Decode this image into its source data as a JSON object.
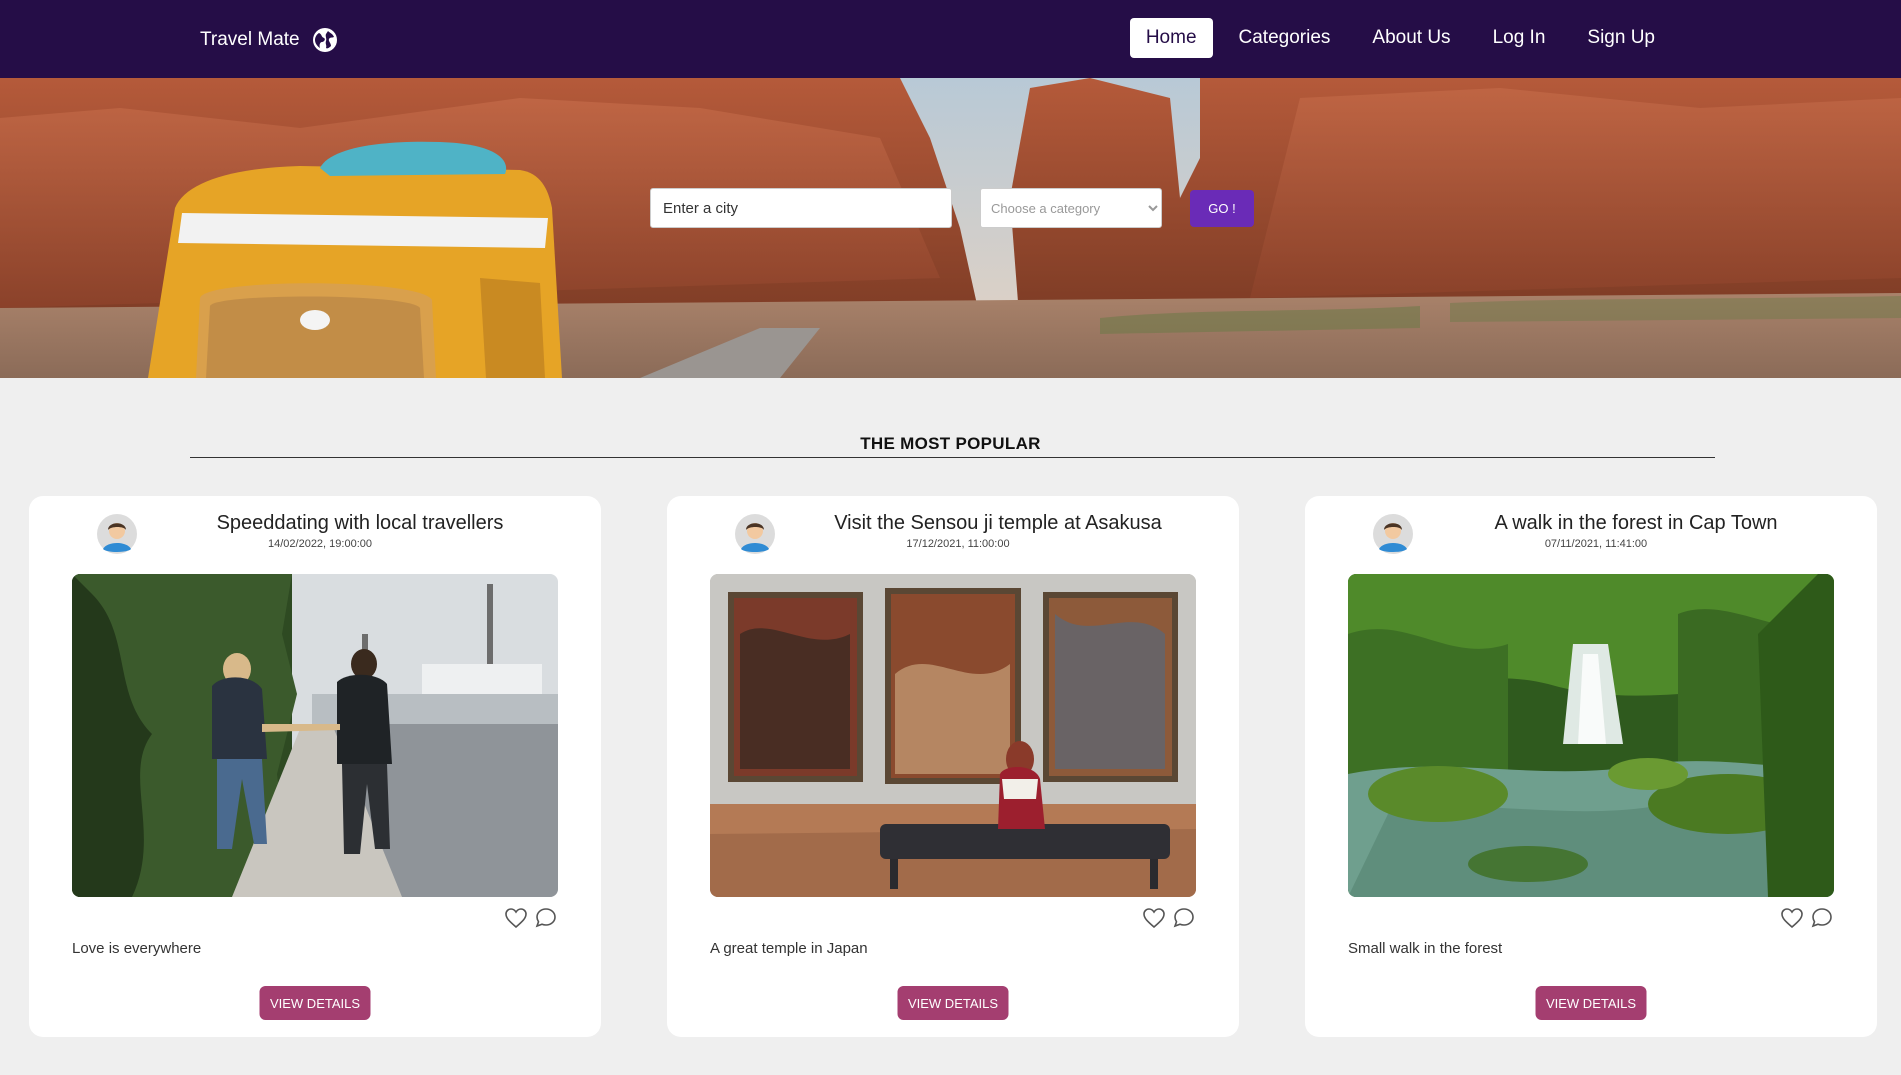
{
  "brand": {
    "name": "Travel Mate",
    "icon": "globe-icon"
  },
  "nav": {
    "items": [
      {
        "label": "Home",
        "active": true
      },
      {
        "label": "Categories",
        "active": false
      },
      {
        "label": "About Us",
        "active": false
      },
      {
        "label": "Log In",
        "active": false
      },
      {
        "label": "Sign Up",
        "active": false
      }
    ]
  },
  "search": {
    "city_placeholder": "Enter a city",
    "category_placeholder": "Choose a category",
    "go_label": "GO !"
  },
  "section": {
    "title": "THE MOST POPULAR"
  },
  "cards": [
    {
      "title": "Speeddating with local travellers",
      "date": "14/02/2022, 19:00:00",
      "description": "Love is everywhere",
      "button": "VIEW DETAILS"
    },
    {
      "title": "Visit the Sensou ji temple at Asakusa",
      "date": "17/12/2021, 11:00:00",
      "description": "A great temple in Japan",
      "button": "VIEW DETAILS"
    },
    {
      "title": "A walk in the forest in Cap Town",
      "date": "07/11/2021, 11:41:00",
      "description": "Small walk in the forest",
      "button": "VIEW DETAILS"
    }
  ],
  "colors": {
    "navbar": "#250d47",
    "go_button": "#6a2bb7",
    "details_button": "#a43e70",
    "page_background": "#efefef"
  }
}
